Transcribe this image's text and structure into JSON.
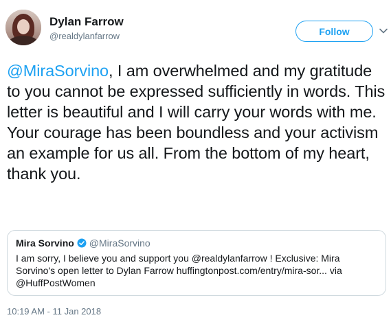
{
  "author": {
    "name": "Dylan Farrow",
    "handle": "@realdylanfarrow"
  },
  "actions": {
    "follow_label": "Follow",
    "menu_icon": "chevron-down-icon"
  },
  "tweet": {
    "mention": "@MiraSorvino",
    "text": ", I am overwhelmed and my gratitude to you cannot be expressed sufficiently in words. This letter is beautiful and I will carry your words with me. Your courage has been boundless and your activism an example for us all. From the bottom of my heart, thank you."
  },
  "quoted_tweet": {
    "name": "Mira Sorvino",
    "verified_icon": "verified-badge-icon",
    "handle": "@MiraSorvino",
    "text": "I am sorry, I believe you and support you @realdylanfarrow ! Exclusive: Mira Sorvino's open letter to Dylan Farrow huffingtonpost.com/entry/mira-sor... via @HuffPostWomen"
  },
  "timestamp": "10:19 AM - 11 Jan 2018",
  "colors": {
    "accent": "#1da1f2",
    "text": "#14171a",
    "muted": "#657786",
    "border": "#cfd9de"
  }
}
